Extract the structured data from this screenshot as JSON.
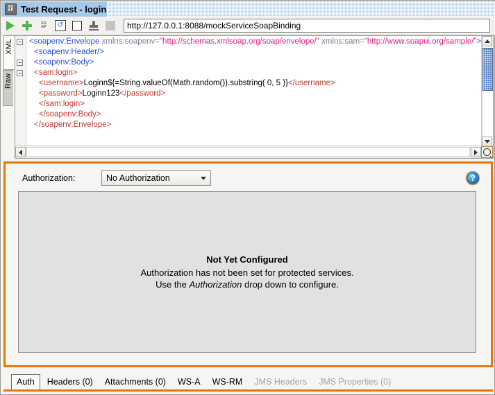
{
  "window": {
    "title": "Test Request - login",
    "icon": "soap-icon"
  },
  "toolbar": {
    "buttons": [
      {
        "name": "submit-request-button",
        "icon": "play-icon",
        "label": ""
      },
      {
        "name": "add-request-button",
        "icon": "plus-icon",
        "label": ""
      },
      {
        "name": "soap-format-button",
        "icon": "soap-icon",
        "label": "SOAP"
      },
      {
        "name": "recompile-button",
        "icon": "refresh-box-icon",
        "label": ""
      },
      {
        "name": "stop-button",
        "icon": "square-icon",
        "label": ""
      },
      {
        "name": "auth-profile-button",
        "icon": "stamp-icon",
        "label": ""
      },
      {
        "name": "disabled-button",
        "icon": "gray-square-icon",
        "label": ""
      }
    ],
    "url": "http://127.0.0.1:8088/mockServiceSoapBinding"
  },
  "editor": {
    "side_tabs": [
      {
        "label": "XML",
        "selected": true
      },
      {
        "label": "Raw",
        "selected": false
      }
    ],
    "lines": [
      {
        "fold": true,
        "parts": [
          {
            "t": "tagb",
            "s": "<soapenv:Envelope"
          },
          {
            "t": "attr",
            "s": " xmlns:soapenv="
          },
          {
            "t": "val",
            "s": "\"http://schemas.xmlsoap.org/soap/envelope/\""
          },
          {
            "t": "attr",
            "s": " xmlns:sam="
          },
          {
            "t": "val",
            "s": "\"http://www.soapui.org/sample/\""
          },
          {
            "t": "tagb",
            "s": ">"
          }
        ]
      },
      {
        "fold": false,
        "indent": 1,
        "parts": [
          {
            "t": "tagb",
            "s": "<soapenv:Header/>"
          }
        ]
      },
      {
        "fold": true,
        "indent": 1,
        "parts": [
          {
            "t": "tagb",
            "s": "<soapenv:Body>"
          }
        ]
      },
      {
        "fold": true,
        "indent": 1,
        "parts": [
          {
            "t": "tag",
            "s": "<sam:login>"
          }
        ]
      },
      {
        "fold": false,
        "indent": 2,
        "parts": [
          {
            "t": "tag",
            "s": "<username>"
          },
          {
            "t": "txt",
            "s": "Loginn${=String.valueOf(Math.random()).substring( 0, 5 )}"
          },
          {
            "t": "tag",
            "s": "</username>"
          }
        ]
      },
      {
        "fold": false,
        "indent": 2,
        "parts": [
          {
            "t": "tag",
            "s": "<password>"
          },
          {
            "t": "txt",
            "s": "Loginn123"
          },
          {
            "t": "tag",
            "s": "</password>"
          }
        ]
      },
      {
        "fold": false,
        "indent": 2,
        "parts": [
          {
            "t": "tag",
            "s": "</sam:login>"
          }
        ]
      },
      {
        "fold": false,
        "indent": 2,
        "parts": [
          {
            "t": "tag",
            "s": "</soapenv:Body>"
          }
        ]
      },
      {
        "fold": false,
        "indent": 1,
        "parts": [
          {
            "t": "tag",
            "s": "</soapenv:Envelope>"
          }
        ]
      }
    ]
  },
  "auth": {
    "label": "Authorization:",
    "selected_option": "No Authorization",
    "options": [
      "No Authorization"
    ],
    "help_icon": "help-circle-icon",
    "empty_state": {
      "title": "Not Yet Configured",
      "line1": "Authorization has not been set for protected services.",
      "line2_pre": "Use the ",
      "line2_em": "Authorization",
      "line2_post": " drop down to configure."
    }
  },
  "bottom_tabs": [
    {
      "label": "Auth",
      "selected": true,
      "disabled": false
    },
    {
      "label": "Headers (0)",
      "selected": false,
      "disabled": false
    },
    {
      "label": "Attachments (0)",
      "selected": false,
      "disabled": false
    },
    {
      "label": "WS-A",
      "selected": false,
      "disabled": false
    },
    {
      "label": "WS-RM",
      "selected": false,
      "disabled": false
    },
    {
      "label": "JMS Headers",
      "selected": false,
      "disabled": true
    },
    {
      "label": "JMS Properties (0)",
      "selected": false,
      "disabled": true
    }
  ],
  "colors": {
    "accent_orange": "#e8750a",
    "titlebar_blue": "#a8c8ea",
    "scroll_thumb": "#5e86c6",
    "panel_gray": "#e1e1e1"
  }
}
